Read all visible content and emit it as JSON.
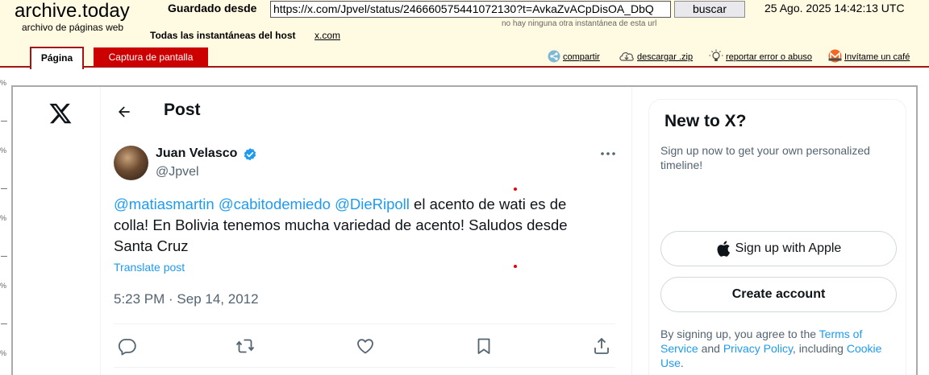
{
  "archive": {
    "logo": "archive.today",
    "subtitle": "archivo de páginas web",
    "saved_from_label": "Guardado desde",
    "url_value": "https://x.com/Jpvel/status/246660575441072130?t=AvkaZvACpDisOA_DbQ",
    "search_button": "buscar",
    "date": "25 Ago. 2025 14:42:13 UTC",
    "no_other": "no hay ninguna otra instantánea de esta url",
    "all_snapshots_label": "Todas las instantáneas  del host",
    "host_link": "x.com",
    "tab_page": "Página",
    "tab_screenshot": "Captura de pantalla",
    "tools": {
      "share": "compartir",
      "download": "descargar .zip",
      "report": "reportar error o abuso",
      "coffee": "Invítame un café"
    },
    "ruler_label": "%"
  },
  "x": {
    "header_title": "Post",
    "author": {
      "name": "Juan Velasco",
      "handle": "@Jpvel",
      "verified": true
    },
    "tweet": {
      "mention1": "@matiasmartin",
      "mention2": "@cabitodemiedo",
      "mention3": "@DieRipoll",
      "body": " el acento de wati es de colla! En Bolivia tenemos mucha variedad de acento! Saludos desde Santa Cruz",
      "translate": "Translate post",
      "timestamp": "5:23 PM · Sep 14, 2012"
    },
    "actions": [
      "reply-icon",
      "retweet-icon",
      "like-icon",
      "bookmark-icon",
      "share-icon"
    ],
    "sidebar": {
      "title": "New to X?",
      "description": "Sign up now to get your own personalized timeline!",
      "apple_button": "Sign up with Apple",
      "create_button": "Create account",
      "terms_prefix": "By signing up, you agree to the ",
      "terms_link": "Terms of Service",
      "terms_and": " and ",
      "privacy_link": "Privacy Policy",
      "terms_including": ", including ",
      "cookie_link": "Cookie Use",
      "terms_end": "."
    },
    "colors": {
      "accent": "#1d9bf0",
      "text": "#0f1419",
      "muted": "#536471"
    }
  }
}
